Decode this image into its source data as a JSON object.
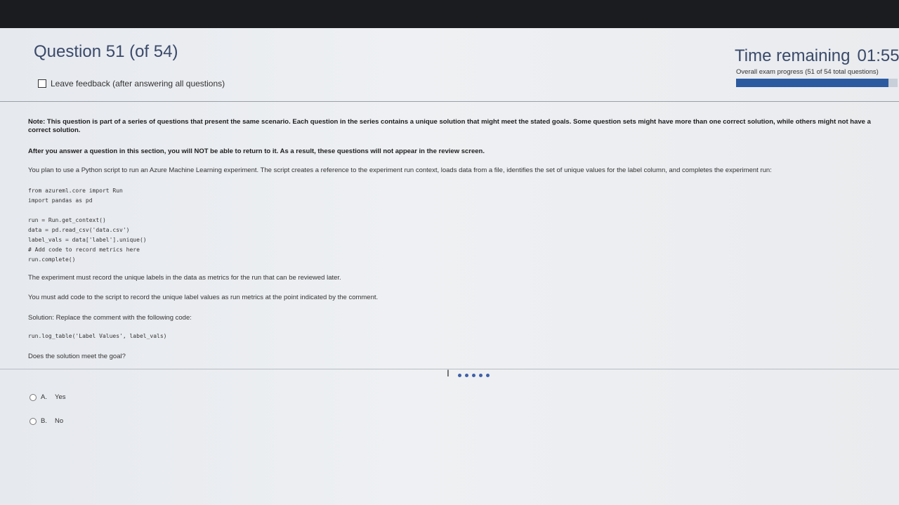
{
  "header": {
    "question_title": "Question 51 (of 54)",
    "feedback_label": "Leave feedback (after answering all questions)",
    "timer_label": "Time remaining",
    "timer_value": "01:55",
    "progress_text": "Overall exam progress (51 of 54 total questions)",
    "progress_fraction": 0.944
  },
  "question": {
    "note": "Note: This question is part of a series of questions that present the same scenario. Each question in the series contains a unique solution that might meet the stated goals. Some question sets might have more than one correct solution, while others might not have a correct solution.",
    "after_answer": "After you answer a question in this section, you will NOT be able to return to it. As a result, these questions will not appear in the review screen.",
    "scenario": "You plan to use a Python script to run an Azure Machine Learning experiment. The script creates a reference to the experiment run context, loads data from a file, identifies the set of unique values for the label column, and completes the experiment run:",
    "code_lines": [
      "from azureml.core import Run",
      "import pandas as pd",
      "",
      "run = Run.get_context()",
      "data = pd.read_csv('data.csv')",
      "label_vals = data['label'].unique()",
      "# Add code to record metrics here",
      "run.complete()"
    ],
    "requirement_1": "The experiment must record the unique labels in the data as metrics for the run that can be reviewed later.",
    "requirement_2": "You must add code to the script to record the unique label values as run metrics at the point indicated by the comment.",
    "solution_label": "Solution: Replace the comment with the following code:",
    "solution_code": "run.log_table('Label Values', label_vals)",
    "prompt": "Does the solution meet the goal?"
  },
  "options": [
    {
      "letter": "A.",
      "text": "Yes"
    },
    {
      "letter": "B.",
      "text": "No"
    }
  ],
  "colors": {
    "accent": "#2c5aa0",
    "title": "#3a4a6a"
  }
}
